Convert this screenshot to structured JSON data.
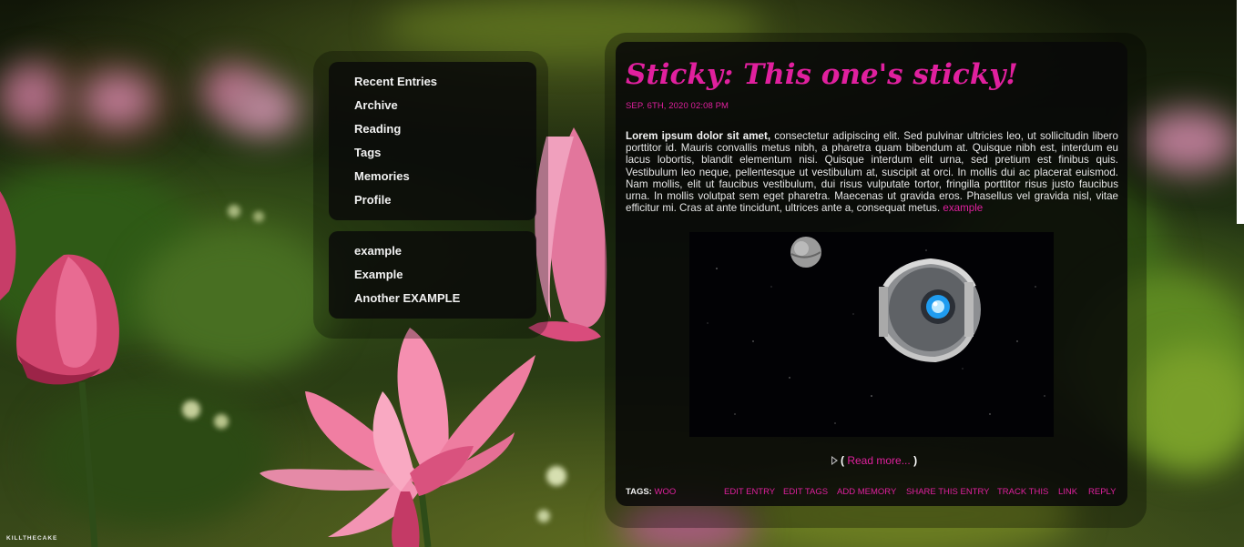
{
  "sidebar": {
    "nav_items": [
      "Recent Entries",
      "Archive",
      "Reading",
      "Tags",
      "Memories",
      "Profile"
    ],
    "link_items": [
      "example",
      "Example",
      "Another EXAMPLE"
    ]
  },
  "entry": {
    "title": "Sticky: This one's sticky!",
    "date": "Sep. 6th, 2020 02:08 pm",
    "body_bold": "Lorem ipsum dolor sit amet,",
    "body_text": " consectetur adipiscing elit. Sed pulvinar ultricies leo, ut sollicitudin libero porttitor id. Mauris convallis metus nibh, a pharetra quam bibendum at. Quisque nibh est, interdum eu lacus lobortis, blandit elementum nisi. Quisque interdum elit urna, sed pretium est finibus quis. Vestibulum leo neque, pellentesque ut vestibulum at, suscipit at orci. In mollis dui ac placerat euismod. Nam mollis, elit ut faucibus vestibulum, dui risus vulputate tortor, fringilla porttitor risus justo faucibus urna. In mollis volutpat sem eget pharetra. Maecenas ut gravida eros. Phasellus vel gravida nisl, vitae efficitur mi. Cras at ante tincidunt, ultrices ante a, consequat metus. ",
    "body_link": "example",
    "read_more_open": "(",
    "read_more": "Read more...",
    "read_more_close": ")",
    "tags_label": "Tags:",
    "tag": "woo",
    "actions": [
      "Edit Entry",
      "Edit Tags",
      "Add Memory",
      "Share This Entry",
      "Track This",
      "Link",
      "Reply"
    ]
  },
  "watermark": "KILLTHECAKE",
  "colors": {
    "accent": "#e0209e",
    "panel": "#0a0a0a",
    "text": "#e6e6e6"
  }
}
